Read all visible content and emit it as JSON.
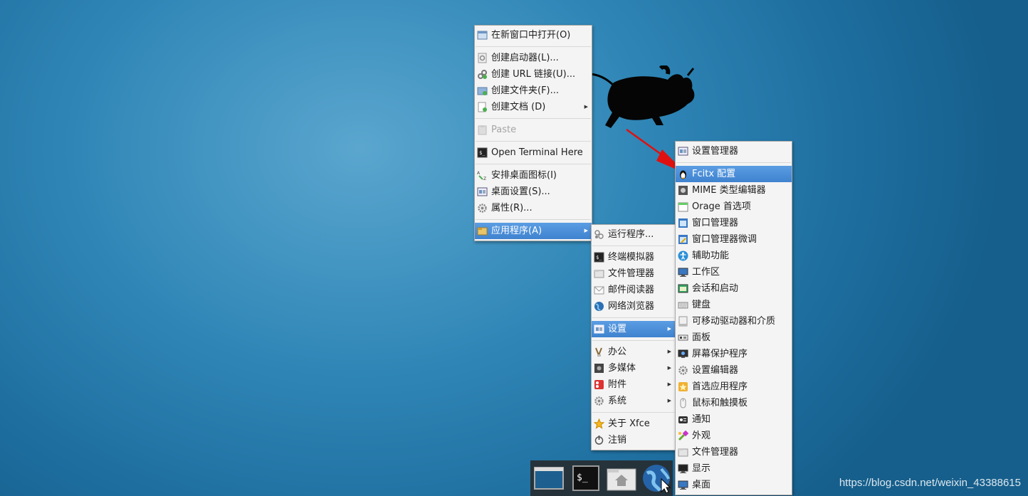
{
  "desktop_menu": {
    "items": [
      {
        "label": "在新窗口中打开(O)",
        "icon": "window-icon"
      },
      {
        "label": "创建启动器(L)...",
        "icon": "launcher-icon"
      },
      {
        "label": "创建 URL 链接(U)...",
        "icon": "link-icon"
      },
      {
        "label": "创建文件夹(F)...",
        "icon": "new-folder-icon"
      },
      {
        "label": "创建文档 (D)",
        "icon": "new-document-icon"
      },
      {
        "label": "Paste",
        "icon": "paste-icon"
      },
      {
        "label": "Open Terminal Here",
        "icon": "terminal-icon"
      },
      {
        "label": "安排桌面图标(I)",
        "icon": "arrange-icon"
      },
      {
        "label": "桌面设置(S)...",
        "icon": "desktop-settings-icon"
      },
      {
        "label": "属性(R)...",
        "icon": "gear-icon"
      },
      {
        "label": "应用程序(A)",
        "icon": "applications-icon"
      }
    ]
  },
  "apps_menu": {
    "items": [
      {
        "label": "运行程序...",
        "icon": "run-icon"
      },
      {
        "label": "终端模拟器",
        "icon": "terminal-icon"
      },
      {
        "label": "文件管理器",
        "icon": "folder-icon"
      },
      {
        "label": "邮件阅读器",
        "icon": "mail-icon"
      },
      {
        "label": "网络浏览器",
        "icon": "globe-icon"
      },
      {
        "label": "设置",
        "icon": "settings-icon"
      },
      {
        "label": "办公",
        "icon": "office-icon"
      },
      {
        "label": "多媒体",
        "icon": "multimedia-icon"
      },
      {
        "label": "附件",
        "icon": "accessories-icon"
      },
      {
        "label": "系统",
        "icon": "gear-icon"
      },
      {
        "label": "关于 Xfce",
        "icon": "star-icon"
      },
      {
        "label": "注销",
        "icon": "power-icon"
      }
    ]
  },
  "settings_menu": {
    "items": [
      {
        "label": "设置管理器",
        "icon": "settings-manager-icon"
      },
      {
        "label": "Fcitx 配置",
        "icon": "penguin-icon"
      },
      {
        "label": "MIME 类型编辑器",
        "icon": "mime-icon"
      },
      {
        "label": "Orage 首选项",
        "icon": "calendar-icon"
      },
      {
        "label": "窗口管理器",
        "icon": "window-manager-icon"
      },
      {
        "label": "窗口管理器微调",
        "icon": "window-tweaks-icon"
      },
      {
        "label": "辅助功能",
        "icon": "accessibility-icon"
      },
      {
        "label": "工作区",
        "icon": "workspace-icon"
      },
      {
        "label": "会话和启动",
        "icon": "session-icon"
      },
      {
        "label": "键盘",
        "icon": "keyboard-icon"
      },
      {
        "label": "可移动驱动器和介质",
        "icon": "drive-icon"
      },
      {
        "label": "面板",
        "icon": "panel-icon"
      },
      {
        "label": "屏幕保护程序",
        "icon": "screensaver-icon"
      },
      {
        "label": "设置编辑器",
        "icon": "gear-icon"
      },
      {
        "label": "首选应用程序",
        "icon": "preferred-apps-icon"
      },
      {
        "label": "鼠标和触摸板",
        "icon": "mouse-icon"
      },
      {
        "label": "通知",
        "icon": "notification-icon"
      },
      {
        "label": "外观",
        "icon": "appearance-icon"
      },
      {
        "label": "文件管理器",
        "icon": "folder-icon"
      },
      {
        "label": "显示",
        "icon": "display-icon"
      },
      {
        "label": "桌面",
        "icon": "desktop-icon"
      }
    ]
  },
  "dock": {
    "items": [
      "desktop-icon",
      "terminal-icon",
      "home-folder-icon",
      "globe-icon"
    ]
  },
  "watermark": "https://blog.csdn.net/weixin_43388615",
  "colors": {
    "selection": "#4a8fdb",
    "arrow": "#e01010"
  }
}
